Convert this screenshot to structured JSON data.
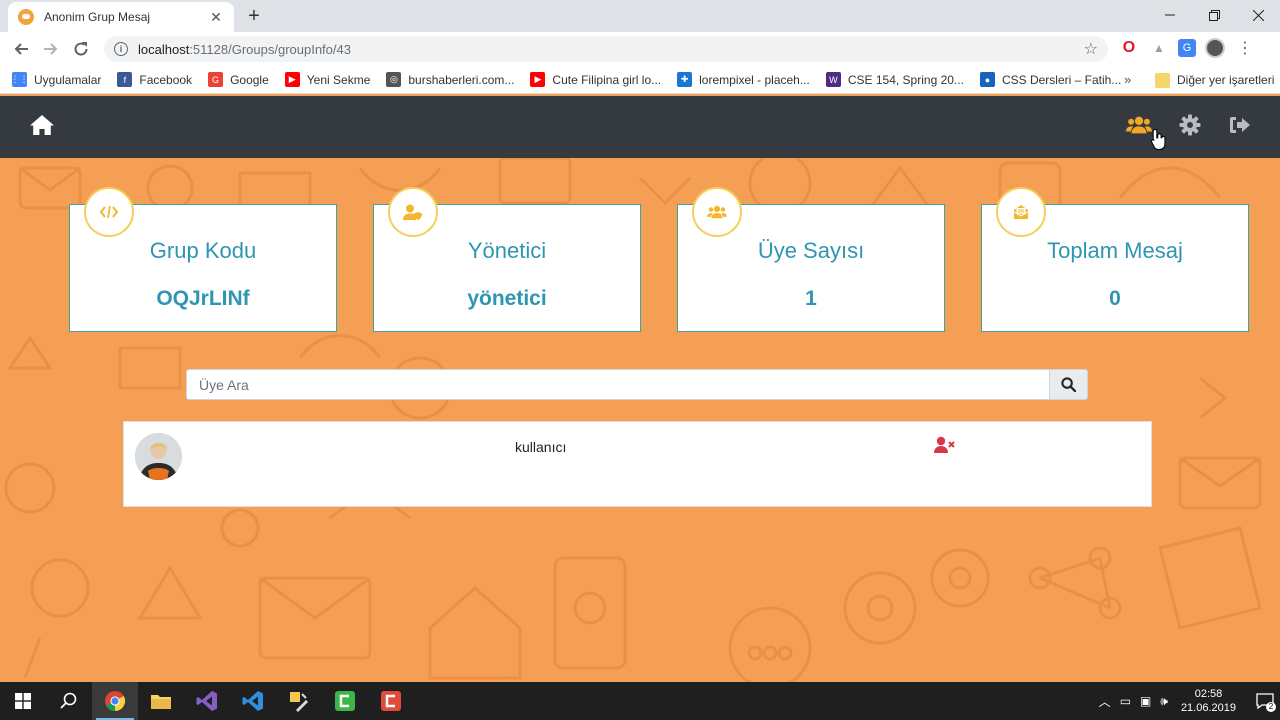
{
  "browser": {
    "tab_title": "Anonim Grup Mesaj",
    "tab_close": "✕",
    "new_tab": "+",
    "url_host": "localhost",
    "url_path": ":51128/Groups/groupInfo/43",
    "bookmarks": [
      {
        "label": "Uygulamalar",
        "icon": "apps-grid-icon",
        "color": "#4285f4"
      },
      {
        "label": "Facebook",
        "icon": "facebook-icon",
        "color": "#3b5998"
      },
      {
        "label": "Google",
        "icon": "google-icon",
        "color": "#ea4335"
      },
      {
        "label": "Yeni Sekme",
        "icon": "youtube-icon",
        "color": "#ff0000"
      },
      {
        "label": "burshaberleri.com...",
        "icon": "globe-icon",
        "color": "#555555"
      },
      {
        "label": "Cute Filipina girl lo...",
        "icon": "youtube-icon",
        "color": "#ff0000"
      },
      {
        "label": "lorempixel - placeh...",
        "icon": "puzzle-icon",
        "color": "#1976d2"
      },
      {
        "label": "CSE 154, Spring 20...",
        "icon": "w-icon",
        "color": "#4b2e83"
      },
      {
        "label": "CSS Dersleri – Fatih...",
        "icon": "drop-icon",
        "color": "#1565c0"
      }
    ],
    "bookmarks_more": "»",
    "bookmarks_other": "Diğer yer işaretleri"
  },
  "cards": [
    {
      "title": "Grup Kodu",
      "value": "OQJrLINf",
      "icon": "code-icon"
    },
    {
      "title": "Yönetici",
      "value": "yönetici",
      "icon": "user-shield-icon"
    },
    {
      "title": "Üye Sayısı",
      "value": "1",
      "icon": "users-icon"
    },
    {
      "title": "Toplam Mesaj",
      "value": "0",
      "icon": "envelope-open-icon"
    }
  ],
  "search": {
    "placeholder": "Üye Ara"
  },
  "members": [
    {
      "name": "kullanıcı"
    }
  ],
  "taskbar": {
    "time": "02:58",
    "date": "21.06.2019",
    "notification_count": "2"
  },
  "colors": {
    "background": "#f59f55",
    "navbar": "#343a40",
    "accent": "#2e96b2",
    "active_icon": "#f5a623",
    "remove_icon": "#dc3545",
    "badge_border": "#f6cf57"
  }
}
